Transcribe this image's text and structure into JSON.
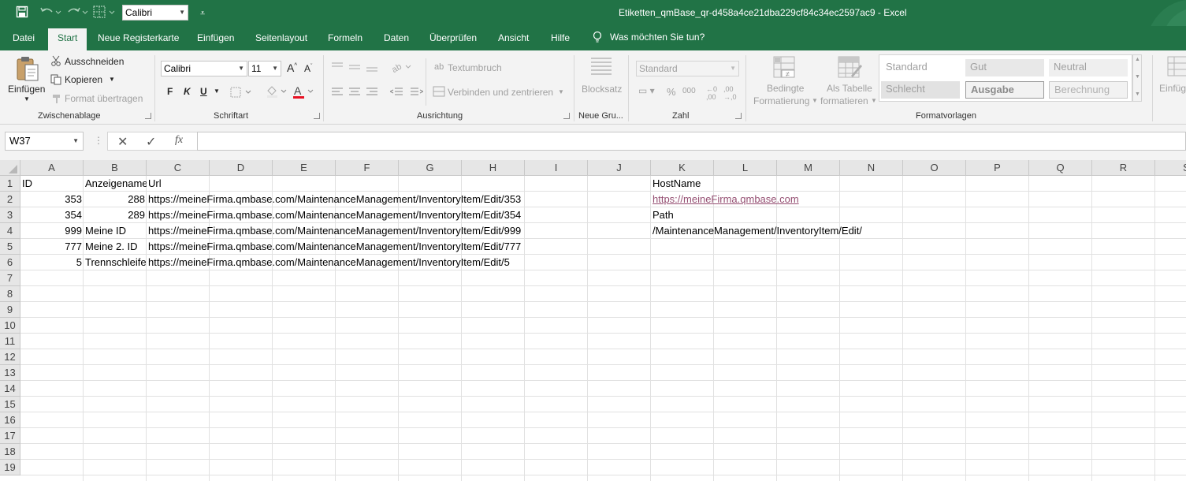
{
  "app": {
    "title": "Etiketten_qmBase_qr-d458a4ce21dba229cf84c34ec2597ac9  -  Excel",
    "quick_access_font": "Calibri"
  },
  "tabs": [
    {
      "label": "Datei"
    },
    {
      "label": "Start",
      "active": true
    },
    {
      "label": "Neue Registerkarte"
    },
    {
      "label": "Einfügen"
    },
    {
      "label": "Seitenlayout"
    },
    {
      "label": "Formeln"
    },
    {
      "label": "Daten"
    },
    {
      "label": "Überprüfen"
    },
    {
      "label": "Ansicht"
    },
    {
      "label": "Hilfe"
    }
  ],
  "tell_me": "Was möchten Sie tun?",
  "ribbon": {
    "clipboard": {
      "paste": "Einfügen",
      "cut": "Ausschneiden",
      "copy": "Kopieren",
      "format_painter": "Format übertragen",
      "label": "Zwischenablage"
    },
    "font": {
      "name": "Calibri",
      "size": "11",
      "bold": "F",
      "italic": "K",
      "underline": "U",
      "label": "Schriftart",
      "font_color": "#e81123"
    },
    "alignment": {
      "wrap_text": "Textumbruch",
      "merge_center": "Verbinden und zentrieren",
      "label": "Ausrichtung"
    },
    "new_group": {
      "blocksatz": "Blocksatz",
      "label": "Neue Gru..."
    },
    "number": {
      "format": "Standard",
      "label": "Zahl"
    },
    "styles": {
      "conditional": "Bedingte",
      "conditional2": "Formatierung",
      "as_table": "Als Tabelle",
      "as_table2": "formatieren",
      "cells": [
        "Standard",
        "Gut",
        "Neutral",
        "Schlecht",
        "Ausgabe",
        "Berechnung"
      ],
      "label": "Formatvorlagen"
    },
    "insert": {
      "label": "Einfüg"
    }
  },
  "formula_bar": {
    "name_box": "W37",
    "fx": "fx",
    "formula": ""
  },
  "grid": {
    "columns": [
      "A",
      "B",
      "C",
      "D",
      "E",
      "F",
      "G",
      "H",
      "I",
      "J",
      "K",
      "L",
      "M",
      "N",
      "O",
      "P",
      "Q",
      "R",
      "S"
    ],
    "rows": [
      "1",
      "2",
      "3",
      "4",
      "5",
      "6",
      "7",
      "8",
      "9",
      "10",
      "11",
      "12",
      "13",
      "14",
      "15",
      "16",
      "17",
      "18",
      "19"
    ],
    "cells": {
      "A1": "ID",
      "B1": "Anzeigename",
      "C1": "Url",
      "K1": "HostName",
      "A2": "353",
      "B2": "288",
      "C2": "https://meineFirma.qmbase.com/MaintenanceManagement/InventoryItem/Edit/353",
      "K2": "https://meineFirma.qmbase.com",
      "A3": "354",
      "B3": "289",
      "C3": "https://meineFirma.qmbase.com/MaintenanceManagement/InventoryItem/Edit/354",
      "K3": "Path",
      "A4": "999",
      "B4": "Meine ID",
      "C4": "https://meineFirma.qmbase.com/MaintenanceManagement/InventoryItem/Edit/999",
      "K4": "/MaintenanceManagement/InventoryItem/Edit/",
      "A5": "777",
      "B5": "Meine 2. ID",
      "C5": "https://meineFirma.qmbase.com/MaintenanceManagement/InventoryItem/Edit/777",
      "A6": "5",
      "B6": "Trennschleifer",
      "C6": "https://meineFirma.qmbase.com/MaintenanceManagement/InventoryItem/Edit/5"
    }
  },
  "colors": {
    "excel_green": "#217346",
    "ribbon_bg": "#f3f3f3",
    "link": "#954f72"
  }
}
